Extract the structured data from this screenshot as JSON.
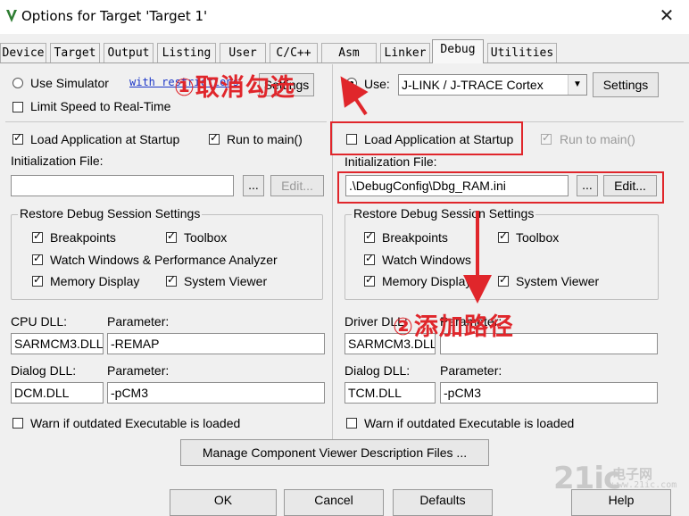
{
  "window": {
    "title": "Options for Target 'Target 1'"
  },
  "tabs": [
    "Device",
    "Target",
    "Output",
    "Listing",
    "User",
    "C/C++",
    "Asm",
    "Linker",
    "Debug",
    "Utilities"
  ],
  "left": {
    "use_simulator": "Use Simulator",
    "restrictions_link": "with restrictions",
    "settings_label": "Settings",
    "limit_speed": "Limit Speed to Real-Time",
    "load_app": "Load Application at Startup",
    "run_to_main": "Run to main()",
    "init_file_label": "Initialization File:",
    "init_file_value": "",
    "browse": "...",
    "edit": "Edit...",
    "restore_title": "Restore Debug Session Settings",
    "breakpoints": "Breakpoints",
    "toolbox": "Toolbox",
    "watch_windows": "Watch Windows & Performance Analyzer",
    "memory_display": "Memory Display",
    "system_viewer": "System Viewer",
    "cpu_dll_label": "CPU DLL:",
    "cpu_param_label": "Parameter:",
    "cpu_dll": "SARMCM3.DLL",
    "cpu_param": "-REMAP",
    "dialog_dll_label": "Dialog DLL:",
    "dialog_param_label": "Parameter:",
    "dialog_dll": "DCM.DLL",
    "dialog_param": "-pCM3",
    "warn": "Warn if outdated Executable is loaded"
  },
  "right": {
    "use": "Use:",
    "driver": "J-LINK / J-TRACE Cortex",
    "settings": "Settings",
    "load_app": "Load Application at Startup",
    "run_to_main": "Run to main()",
    "init_file_label": "Initialization File:",
    "init_file_value": ".\\DebugConfig\\Dbg_RAM.ini",
    "browse": "...",
    "edit": "Edit...",
    "restore_title": "Restore Debug Session Settings",
    "breakpoints": "Breakpoints",
    "toolbox": "Toolbox",
    "watch_windows": "Watch Windows",
    "memory_display": "Memory Display",
    "system_viewer": "System Viewer",
    "driver_dll_label": "Driver DLL:",
    "driver_param_label": "Parameter:",
    "driver_dll": "SARMCM3.DLL",
    "driver_param": "",
    "dialog_dll_label": "Dialog DLL:",
    "dialog_param_label": "Parameter:",
    "dialog_dll": "TCM.DLL",
    "dialog_param": "-pCM3",
    "warn": "Warn if outdated Executable is loaded"
  },
  "manage_button": "Manage Component Viewer Description Files ...",
  "bottom": {
    "ok": "OK",
    "cancel": "Cancel",
    "defaults": "Defaults",
    "help": "Help"
  },
  "annotations": {
    "uncheck": "①取消勾选",
    "add_path": "②添加路径"
  },
  "watermark": {
    "logo": "21ic",
    "cn": "电子网",
    "url": "www.21ic.com"
  },
  "colors": {
    "annotation_red": "#e0262b",
    "link_blue": "#1a35c8"
  }
}
